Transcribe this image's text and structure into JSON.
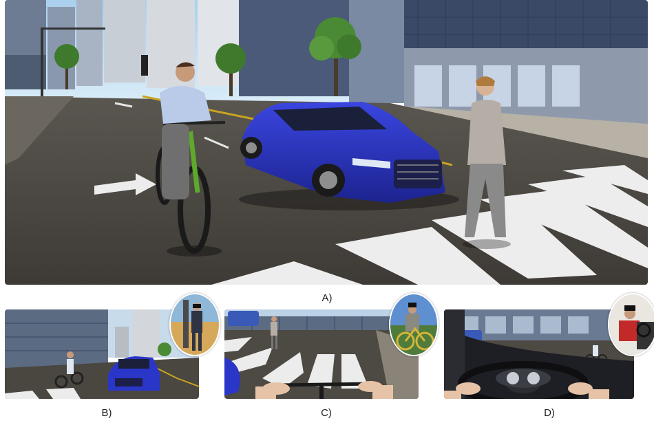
{
  "figure": {
    "panels": [
      {
        "id": "A",
        "label": "A)"
      },
      {
        "id": "B",
        "label": "B)"
      },
      {
        "id": "C",
        "label": "C)"
      },
      {
        "id": "D",
        "label": "D)"
      }
    ]
  },
  "colors": {
    "car_blue": "#2a36c8",
    "road": "#4a4640",
    "sky": "#9ec9ea",
    "crosswalk": "#f2f2f2",
    "building_glass": "#5b6f8a"
  }
}
